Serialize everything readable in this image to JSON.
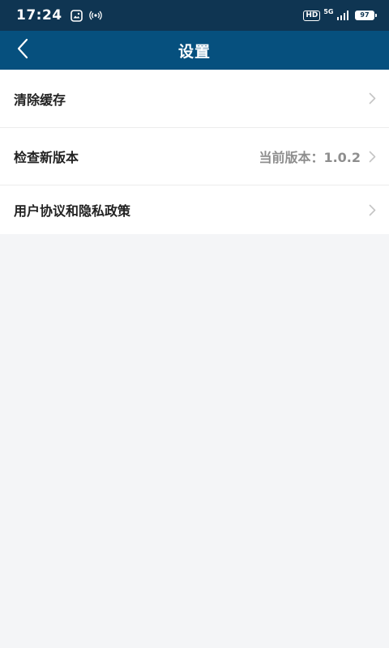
{
  "status_bar": {
    "time": "17:24",
    "left_icons": [
      "gallery-icon",
      "hotspot-icon"
    ],
    "hd_label": "HD",
    "network_label": "5G",
    "battery_level": "97"
  },
  "header": {
    "title": "设置",
    "back_icon": "chevron-left-icon"
  },
  "settings": {
    "items": [
      {
        "label": "清除缓存",
        "value": ""
      },
      {
        "label": "检查新版本",
        "value": "当前版本：1.0.2"
      },
      {
        "label": "用户协议和隐私政策",
        "value": ""
      }
    ]
  },
  "colors": {
    "status_bar_bg": "#0f3552",
    "nav_bar_bg": "#06507e",
    "page_bg": "#f4f5f7",
    "chevron": "#c4c4c4"
  }
}
